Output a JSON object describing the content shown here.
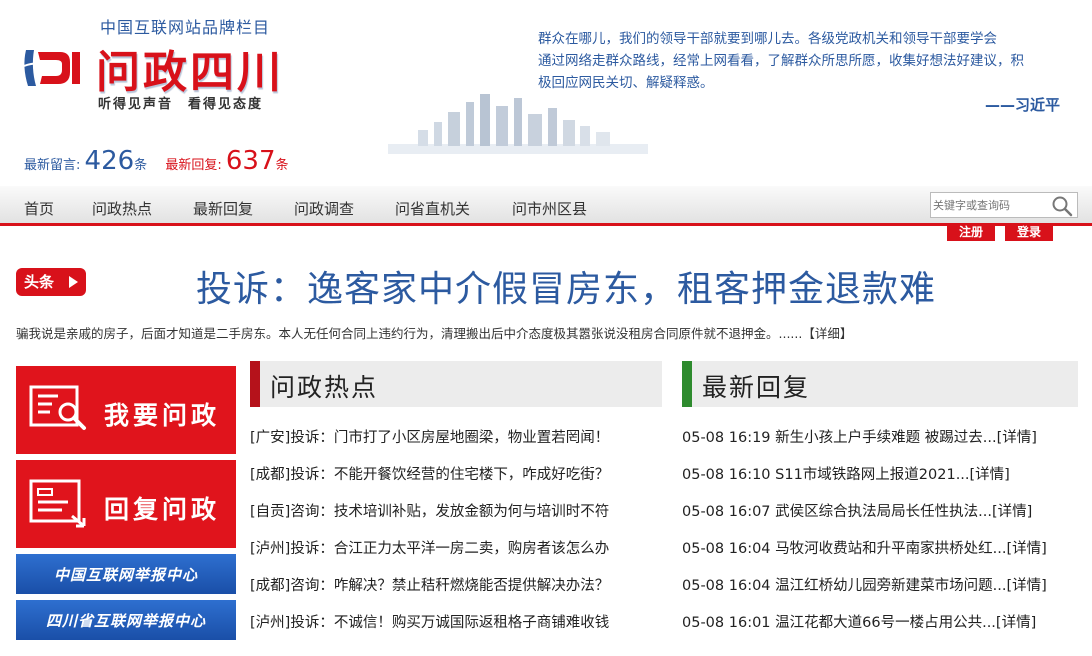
{
  "header": {
    "brand_sub": "中国互联网站品牌栏目",
    "logo_title": "问政四川",
    "slogan": "听得见声音　看得见态度",
    "quote_lines": [
      "群众在哪儿，我们的领导干部就要到哪儿去。各级党政机关和领导干部要学会",
      "通过网络走群众路线，经常上网看看，了解群众所思所愿，收集好想法好建议，积",
      "极回应网民关切、解疑释惑。"
    ],
    "quote_author": "——习近平"
  },
  "stats": {
    "latest_messages_label": "最新留言:",
    "latest_messages_count": "426",
    "latest_messages_unit": "条",
    "latest_replies_label": "最新回复:",
    "latest_replies_count": "637",
    "latest_replies_unit": "条"
  },
  "nav": {
    "items": [
      "首页",
      "问政热点",
      "最新回复",
      "问政调查",
      "问省直机关",
      "问市州区县"
    ],
    "search_placeholder": "关键字或查询码",
    "register_label": "注册",
    "login_label": "登录"
  },
  "headline": {
    "tag": "头条",
    "title": "投诉：逸客家中介假冒房东，租客押金退款难",
    "summary": "骗我说是亲戚的房子，后面才知道是二手房东。本人无任何合同上违约行为，清理搬出后中介态度极其嚣张说没租房合同原件就不退押金。......",
    "more": "【详细】"
  },
  "banners": {
    "ask": "我要问政",
    "reply": "回复问政",
    "china_report": "中国互联网举报中心",
    "sichuan_report": "四川省互联网举报中心"
  },
  "hot": {
    "title": "问政热点",
    "items": [
      "[广安]投诉：门市打了小区房屋地圈梁，物业置若罔闻！",
      "[成都]投诉：不能开餐饮经营的住宅楼下，咋成好吃街？",
      "[自贡]咨询：技术培训补贴，发放金额为何与培训时不符",
      "[泸州]投诉：合江正力太平洋一房二卖，购房者该怎么办",
      "[成都]咨询：咋解决？禁止秸秆燃烧能否提供解决办法？",
      "[泸州]投诉：不诚信！购买万诚国际返租格子商铺难收钱"
    ]
  },
  "latest": {
    "title": "最新回复",
    "items": [
      "05-08 16:19 新生小孩上户手续难题 被踢过去...[详情]",
      "05-08 16:10 S11市域铁路网上报道2021...[详情]",
      "05-08 16:07 武侯区综合执法局局长任性执法...[详情]",
      "05-08 16:04 马牧河收费站和升平南家拱桥处红...[详情]",
      "05-08 16:04 温江红桥幼儿园旁新建菜市场问题...[详情]",
      "05-08 16:01 温江花都大道66号一楼占用公共...[详情]"
    ]
  },
  "colors": {
    "brand_red": "#d8111a",
    "brand_blue": "#2c5aa0",
    "hot_bar": "#b5121b",
    "latest_bar": "#2e8b2e"
  }
}
